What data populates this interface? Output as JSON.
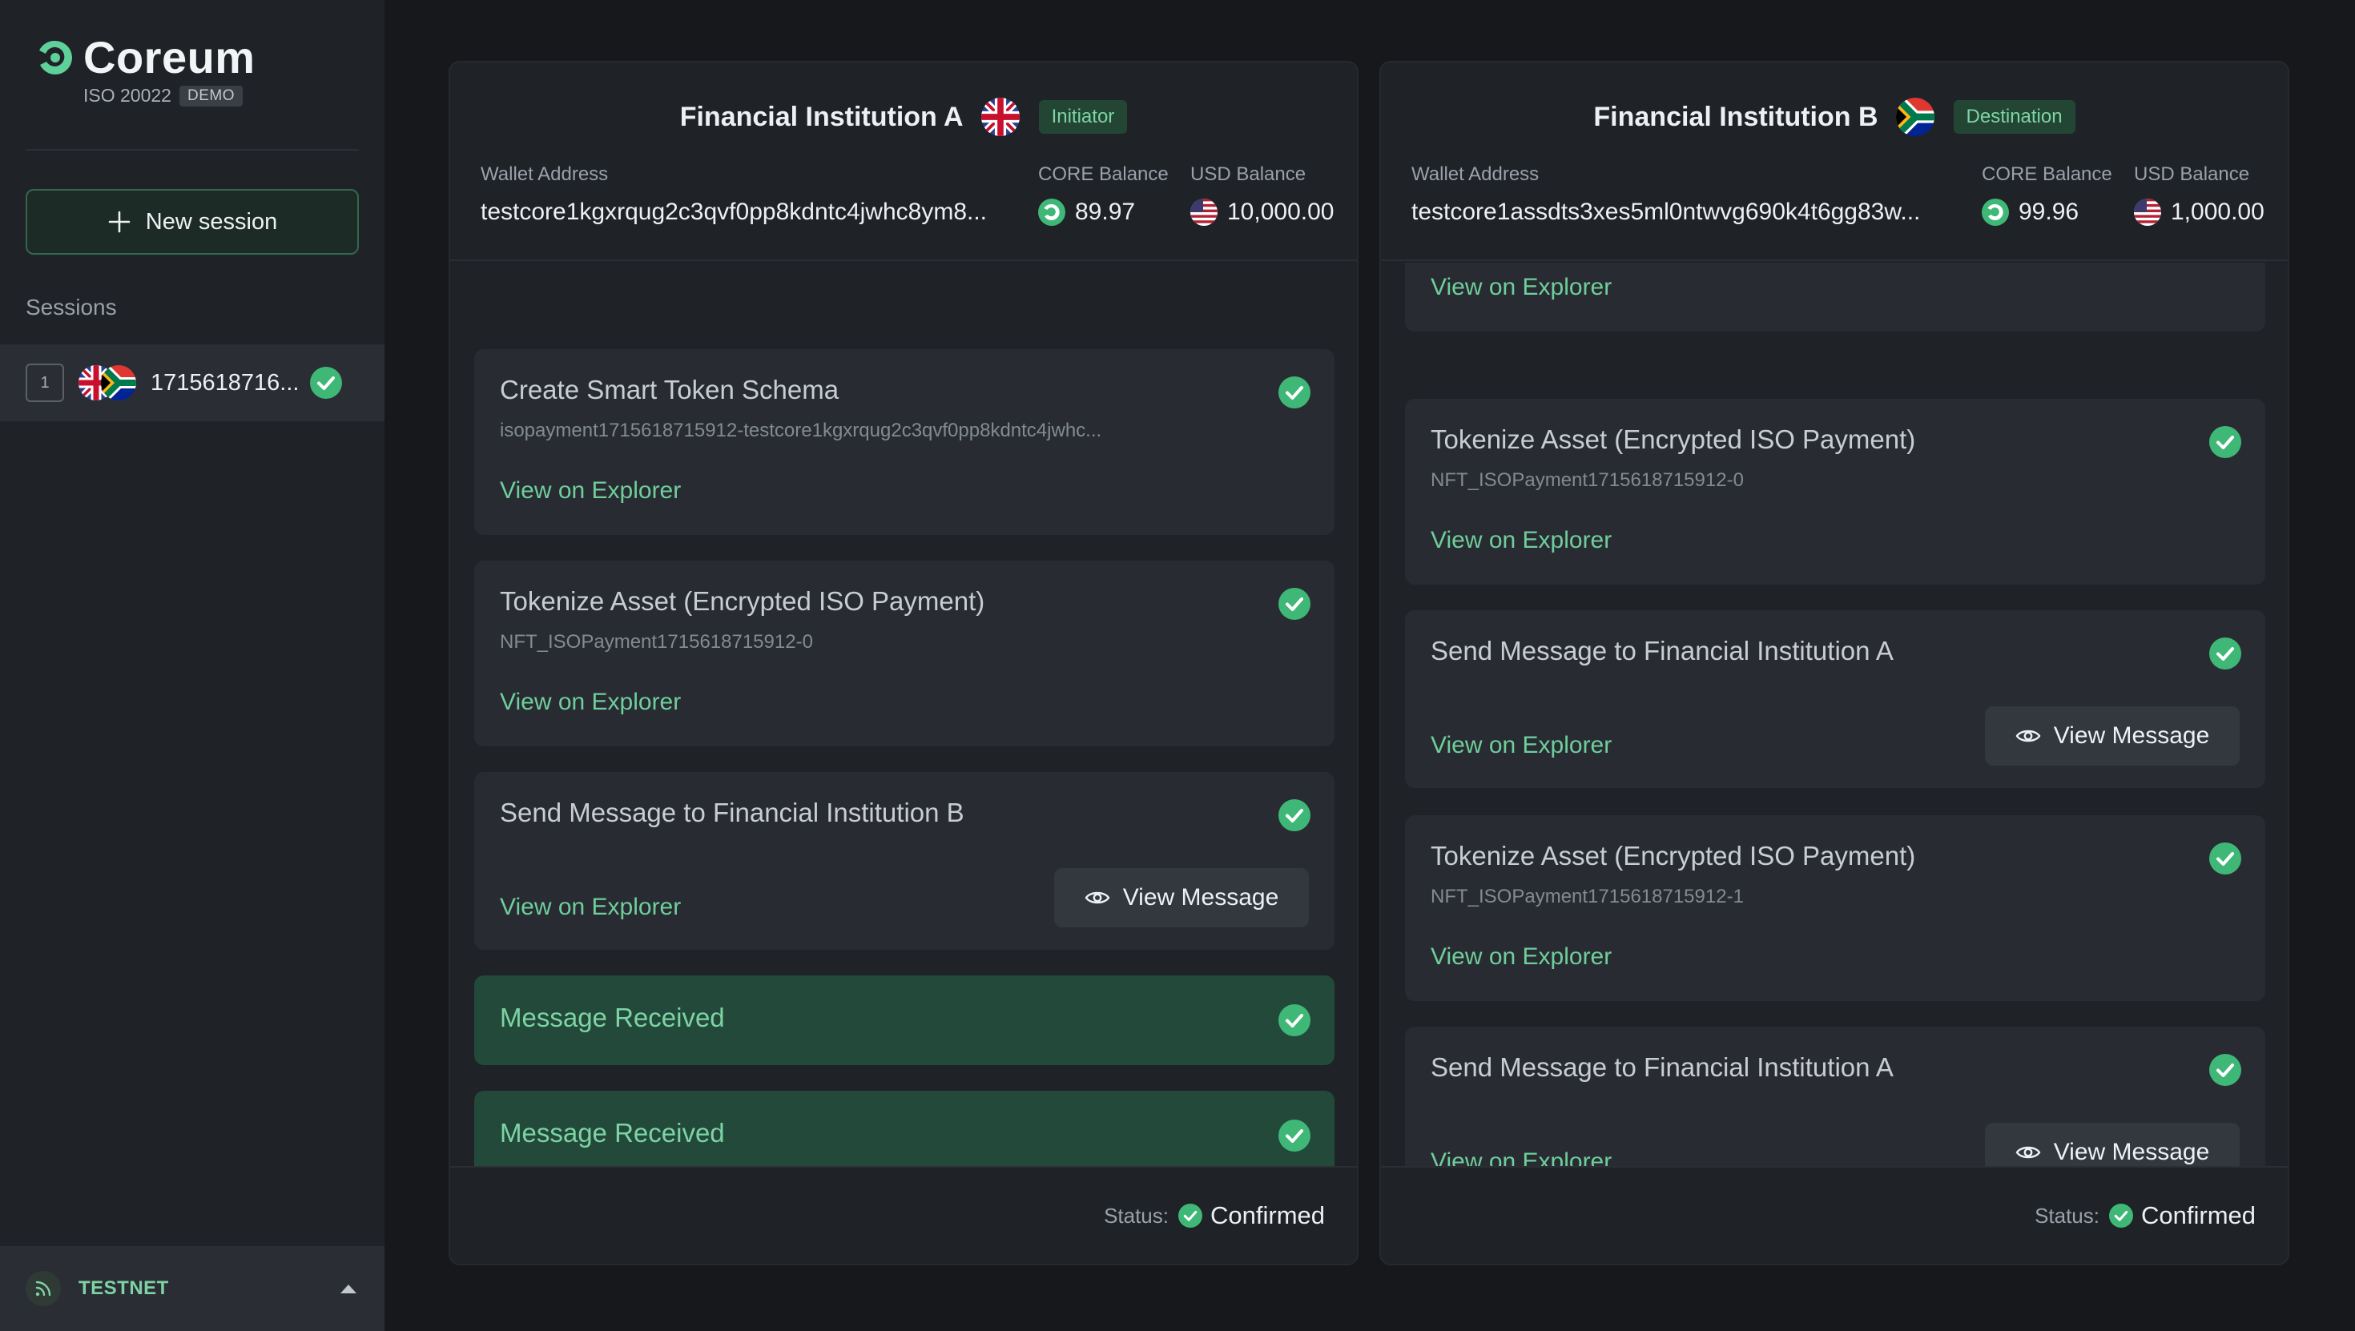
{
  "sidebar": {
    "app_name": "Coreum",
    "subtitle": "ISO 20022",
    "badge": "DEMO",
    "new_session_label": "New session",
    "sessions_heading": "Sessions",
    "sessions": [
      {
        "number": "1",
        "id": "1715618716...",
        "status": "confirmed"
      }
    ],
    "network_label": "TESTNET"
  },
  "panels": [
    {
      "name": "Financial Institution A",
      "flag": "uk-flag",
      "role": "Initiator",
      "wallet_label": "Wallet Address",
      "wallet_address": "testcore1kgxrqug2c3qvf0pp8kdntc4jwhc8ym8...",
      "core_balance_label": "CORE Balance",
      "core_balance": "89.97",
      "usd_balance_label": "USD Balance",
      "usd_balance": "10,000.00",
      "steps": [
        {
          "title": "Create Smart Token Schema",
          "subtitle": "isopayment1715618715912-testcore1kgxrqug2c3qvf0pp8kdntc4jwhc...",
          "link": "View on Explorer"
        },
        {
          "title": "Tokenize Asset (Encrypted ISO Payment)",
          "subtitle": "NFT_ISOPayment1715618715912-0",
          "link": "View on Explorer"
        },
        {
          "title": "Send Message to Financial Institution B",
          "link": "View on Explorer",
          "action": "View Message"
        },
        {
          "title": "Message Received"
        },
        {
          "title": "Message Received"
        }
      ],
      "status_label": "Status:",
      "status": "Confirmed"
    },
    {
      "name": "Financial Institution B",
      "flag": "south-africa-flag",
      "role": "Destination",
      "wallet_label": "Wallet Address",
      "wallet_address": "testcore1assdts3xes5ml0ntwvg690k4t6gg83w...",
      "core_balance_label": "CORE Balance",
      "core_balance": "99.96",
      "usd_balance_label": "USD Balance",
      "usd_balance": "1,000.00",
      "steps": [
        {
          "link": "View on Explorer"
        },
        {
          "title": "Tokenize Asset (Encrypted ISO Payment)",
          "subtitle": "NFT_ISOPayment1715618715912-0",
          "link": "View on Explorer"
        },
        {
          "title": "Send Message to Financial Institution A",
          "link": "View on Explorer",
          "action": "View Message"
        },
        {
          "title": "Tokenize Asset (Encrypted ISO Payment)",
          "subtitle": "NFT_ISOPayment1715618715912-1",
          "link": "View on Explorer"
        },
        {
          "title": "Send Message to Financial Institution A",
          "link": "View on Explorer",
          "action": "View Message"
        }
      ],
      "status_label": "Status:",
      "status": "Confirmed"
    }
  ],
  "colors": {
    "background": "#16181c",
    "sidebar": "#1f2227",
    "card": "#282c32",
    "accent": "#6fce9b",
    "received_card": "#22493a",
    "check": "#3fb877"
  }
}
